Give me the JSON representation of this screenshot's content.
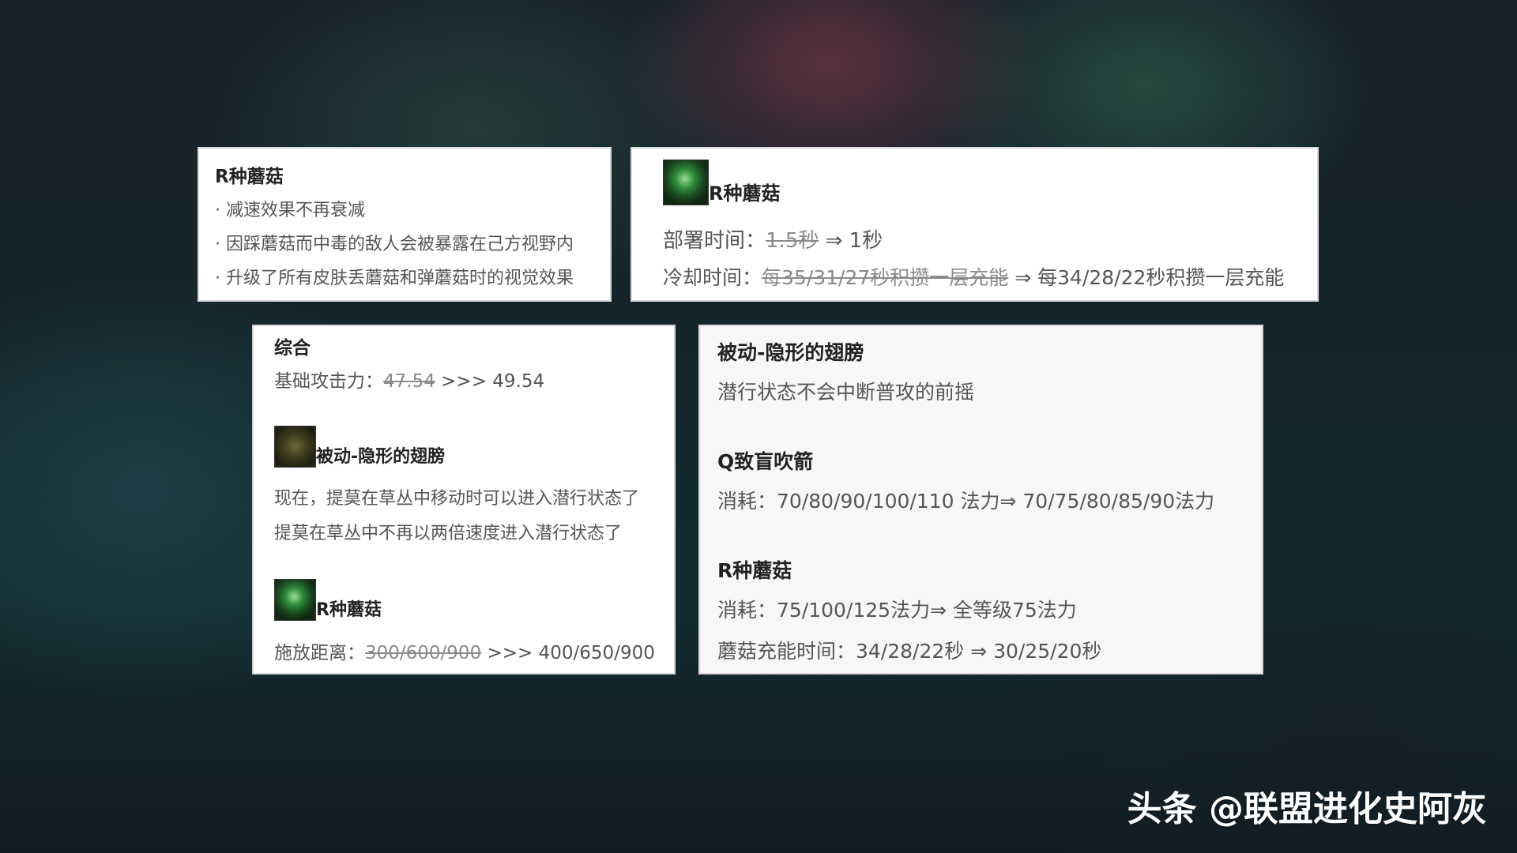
{
  "card1": {
    "title": "R种蘑菇",
    "lines": [
      "· 减速效果不再衰减",
      "· 因踩蘑菇而中毒的敌人会被暴露在己方视野内",
      "· 升级了所有皮肤丢蘑菇和弹蘑菇时的视觉效果"
    ]
  },
  "card2": {
    "icon": "mushroom-skill-icon",
    "title": "R种蘑菇",
    "deploy": {
      "label": "部署时间：",
      "old": "1.5秒",
      "arrow": " ⇒ ",
      "new": "1秒"
    },
    "cooldown": {
      "label": "冷却时间：",
      "old": "每35/31/27秒积攒一层充能",
      "arrow": " ⇒ ",
      "new": "每34/28/22秒积攒一层充能"
    }
  },
  "card3": {
    "title": "综合",
    "attack": {
      "label": "基础攻击力：",
      "old": "47.54",
      "arrow": " >>> ",
      "new": "49.54"
    },
    "passive": {
      "icon": "teemo-passive-icon",
      "title": "被动-隐形的翅膀",
      "lines": [
        "现在，提莫在草丛中移动时可以进入潜行状态了",
        "提莫在草丛中不再以两倍速度进入潜行状态了"
      ]
    },
    "ult": {
      "icon": "mushroom-skill-icon",
      "title": "R种蘑菇",
      "range": {
        "label": "施放距离：",
        "old": "300/600/900",
        "arrow": " >>> ",
        "new": "400/650/900"
      }
    }
  },
  "card4": {
    "passive_title": "被动-隐形的翅膀",
    "passive_line": "潜行状态不会中断普攻的前摇",
    "q_title": "Q致盲吹箭",
    "q_line": "消耗：70/80/90/100/110 法力⇒ 70/75/80/85/90法力",
    "r_title": "R种蘑菇",
    "r_cost": "消耗：75/100/125法力⇒ 全等级75法力",
    "r_recharge": "蘑菇充能时间：34/28/22秒 ⇒ 30/25/20秒"
  },
  "watermark": "头条 @联盟进化史阿灰"
}
